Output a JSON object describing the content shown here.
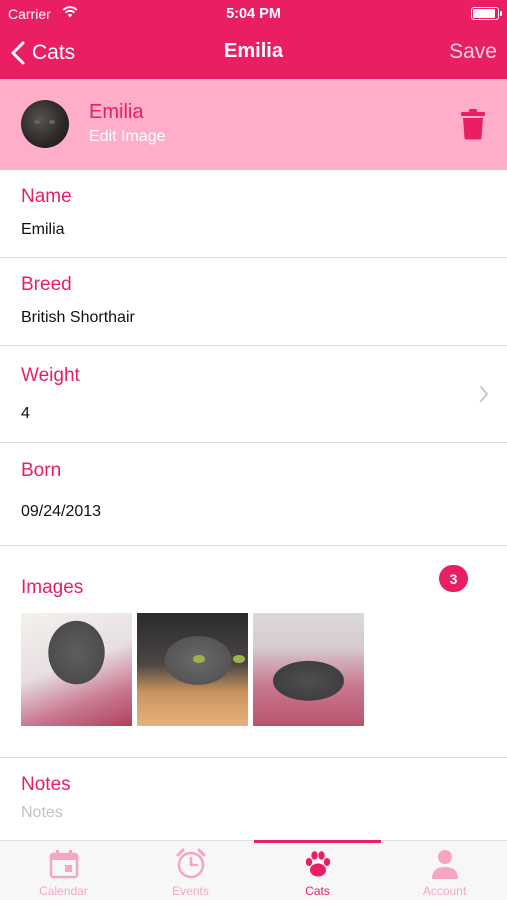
{
  "status_bar": {
    "carrier": "Carrier",
    "time": "5:04 PM",
    "battery_level": 1.0
  },
  "nav": {
    "back_label": "Cats",
    "title": "Emilia",
    "save_label": "Save"
  },
  "profile": {
    "name": "Emilia",
    "edit_image_label": "Edit Image"
  },
  "fields": {
    "name": {
      "label": "Name",
      "value": "Emilia"
    },
    "breed": {
      "label": "Breed",
      "value": "British Shorthair"
    },
    "weight": {
      "label": "Weight",
      "value": "4"
    },
    "born": {
      "label": "Born",
      "value": "09/24/2013"
    },
    "images": {
      "label": "Images",
      "count": "3"
    },
    "notes": {
      "label": "Notes",
      "placeholder": "Notes"
    }
  },
  "tabs": [
    {
      "label": "Calendar",
      "icon": "calendar-icon"
    },
    {
      "label": "Events",
      "icon": "alarm-clock-icon"
    },
    {
      "label": "Cats",
      "icon": "paw-icon"
    },
    {
      "label": "Account",
      "icon": "person-icon"
    }
  ],
  "active_tab": "Cats",
  "colors": {
    "accent": "#e91e63",
    "banner": "#ffaec9",
    "inactive_tab": "#f7a6bf"
  }
}
